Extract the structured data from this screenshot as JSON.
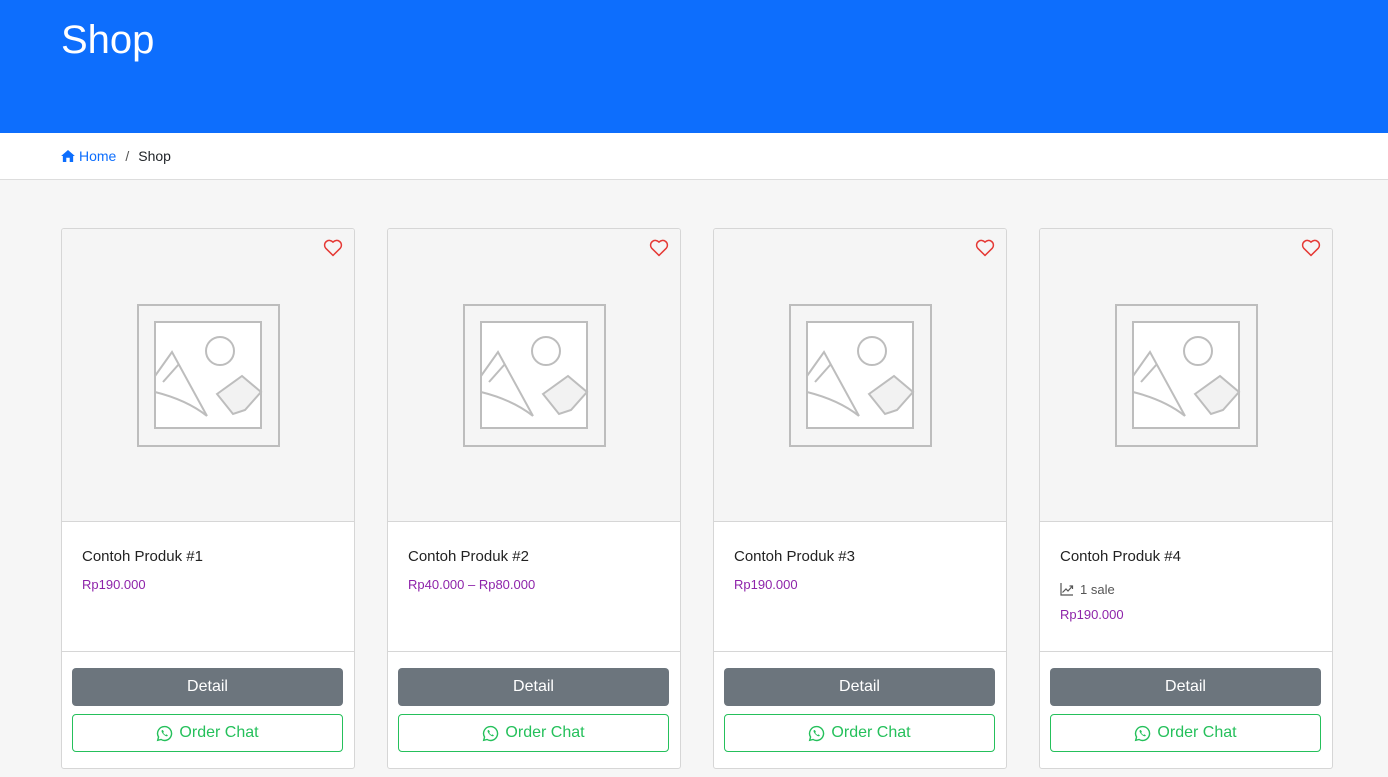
{
  "hero": {
    "title": "Shop"
  },
  "breadcrumb": {
    "home": "Home",
    "current": "Shop",
    "separator": "/"
  },
  "colors": {
    "primary": "#0d6efd",
    "price": "#8e24aa",
    "whatsapp": "#25c05b",
    "detail": "#6c757d",
    "heart": "#e53935"
  },
  "products": [
    {
      "title": "Contoh Produk #1",
      "price": "Rp190.000",
      "sale": "",
      "detail_label": "Detail",
      "chat_label": "Order Chat"
    },
    {
      "title": "Contoh Produk #2",
      "price": "Rp40.000 – Rp80.000",
      "sale": "",
      "detail_label": "Detail",
      "chat_label": "Order Chat"
    },
    {
      "title": "Contoh Produk #3",
      "price": "Rp190.000",
      "sale": "",
      "detail_label": "Detail",
      "chat_label": "Order Chat"
    },
    {
      "title": "Contoh Produk #4",
      "price": "Rp190.000",
      "sale": "1 sale",
      "detail_label": "Detail",
      "chat_label": "Order Chat"
    }
  ],
  "icons": {
    "home": "home-icon",
    "heart": "heart-icon",
    "whatsapp": "whatsapp-icon",
    "sales": "trending-up-icon",
    "placeholder": "image-placeholder-icon"
  }
}
